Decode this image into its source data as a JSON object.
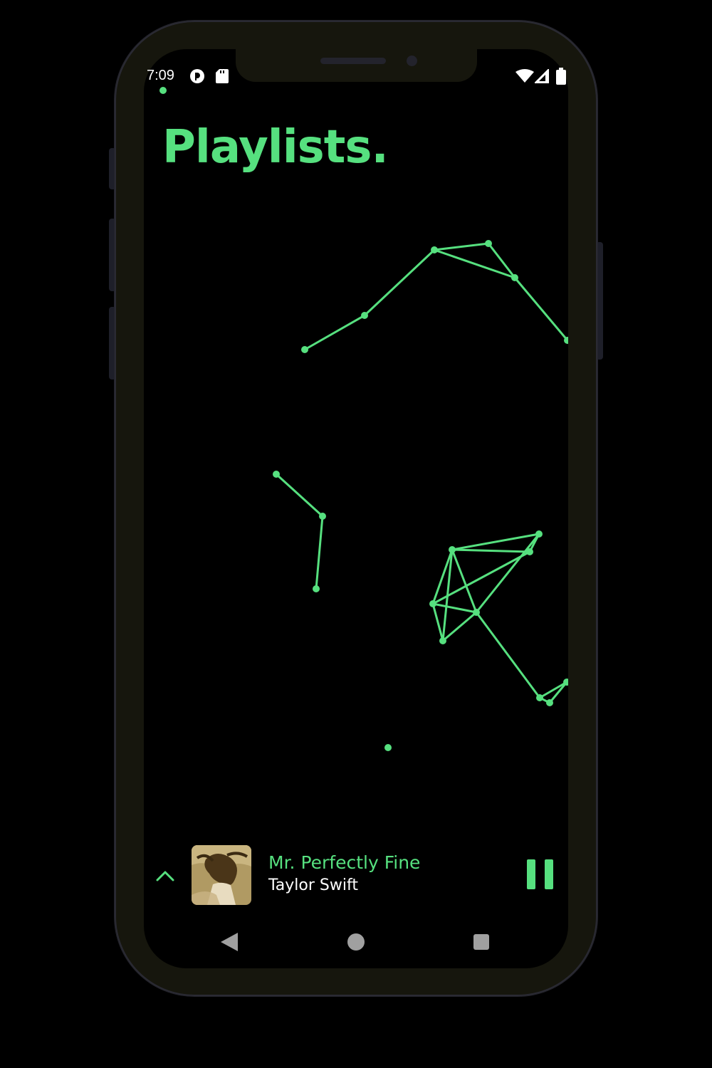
{
  "status_bar": {
    "time": "7:09",
    "left_icons": [
      "app-notification-icon",
      "sd-card-icon"
    ],
    "right_icons": [
      "wifi-icon",
      "cellular-signal-icon",
      "battery-icon"
    ]
  },
  "page": {
    "title": "Playlists."
  },
  "playlist_graph": {
    "description_icon": "constellation-graph",
    "accent_color": "#56e07f"
  },
  "now_playing": {
    "expand_icon": "chevron-up-icon",
    "track_title": "Mr. Perfectly Fine",
    "artist": "Taylor Swift",
    "album_art_icon": "album-art",
    "control_icon": "pause-icon"
  },
  "navigation_bar": {
    "back_icon": "back-triangle-icon",
    "home_icon": "home-circle-icon",
    "recents_icon": "recents-square-icon"
  },
  "colors": {
    "accent": "#56e07f",
    "background": "#000000",
    "phone_frame": "#16160d",
    "text_primary": "#ffffff",
    "nav_icons": "#a0a0a0"
  }
}
